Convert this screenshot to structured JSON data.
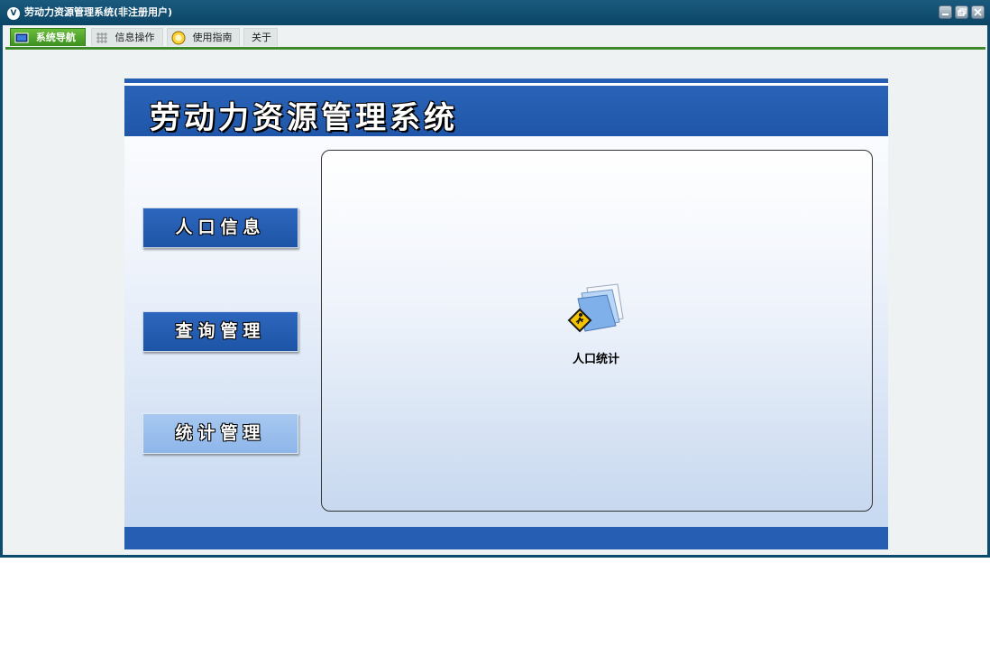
{
  "window": {
    "title": "劳动力资源管理系统(非注册用户)",
    "controls": [
      "minimize",
      "restore",
      "close"
    ]
  },
  "menu": {
    "tabs": [
      {
        "label": "系统导航",
        "icon": "monitor-icon",
        "active": true
      },
      {
        "label": "信息操作",
        "icon": "grid-icon",
        "active": false
      },
      {
        "label": "使用指南",
        "icon": "help-icon",
        "active": false
      },
      {
        "label": "关于",
        "icon": "",
        "active": false
      }
    ]
  },
  "banner": {
    "title": "劳动力资源管理系统"
  },
  "nav": {
    "buttons": [
      {
        "label": "人口信息",
        "selected": false
      },
      {
        "label": "查询管理",
        "selected": false
      },
      {
        "label": "统计管理",
        "selected": true
      }
    ]
  },
  "panel": {
    "items": [
      {
        "label": "人口统计",
        "icon": "pedestrian-folder-icon"
      }
    ]
  },
  "colors": {
    "titlebar": "#0b4566",
    "banner": "#2a63b8",
    "active_tab": "#3a8f1f",
    "nav_button": "#2d67bd",
    "nav_button_selected": "#9cc0ee"
  }
}
